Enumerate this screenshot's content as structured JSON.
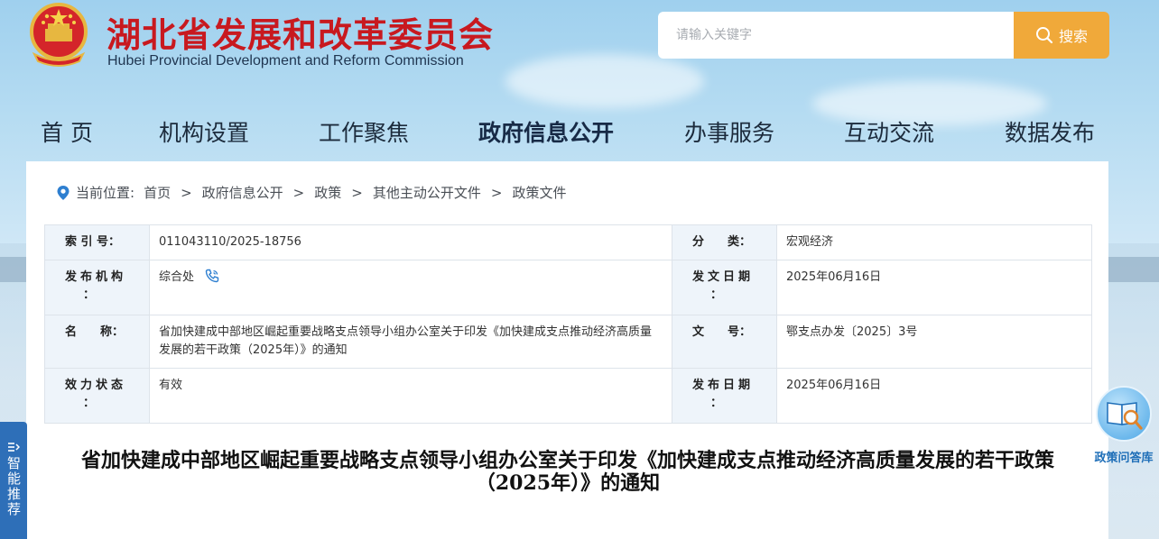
{
  "header": {
    "title_cn": "湖北省发展和改革委员会",
    "title_en": "Hubei Provincial Development and Reform Commission"
  },
  "search": {
    "placeholder": "请输入关键字",
    "button_label": "搜索"
  },
  "nav": {
    "items": [
      {
        "label": "首 页"
      },
      {
        "label": "机构设置"
      },
      {
        "label": "工作聚焦"
      },
      {
        "label": "政府信息公开"
      },
      {
        "label": "办事服务"
      },
      {
        "label": "互动交流"
      },
      {
        "label": "数据发布"
      }
    ],
    "active_index": 3
  },
  "breadcrumb": {
    "prefix": "当前位置:",
    "items": [
      "首页",
      "政府信息公开",
      "政策",
      "其他主动公开文件",
      "政策文件"
    ],
    "separator": ">"
  },
  "meta": {
    "index_label": "索 引 号：",
    "index_value": "011043110/2025-18756",
    "category_label": "分　　类：",
    "category_value": "宏观经济",
    "publisher_label_chars": [
      "发",
      "布",
      "机",
      "构",
      "："
    ],
    "publisher_value": "综合处",
    "issue_date_label_chars": [
      "发",
      "文",
      "日",
      "期",
      "："
    ],
    "issue_date_value": "2025年06月16日",
    "name_label": "名　　称：",
    "name_value": "省加快建成中部地区崛起重要战略支点领导小组办公室关于印发《加快建成支点推动经济高质量发展的若干政策（2025年）》的通知",
    "doc_no_label": "文　　号：",
    "doc_no_value": "鄂支点办发〔2025〕3号",
    "status_label_chars": [
      "效",
      "力",
      "状",
      "态",
      "："
    ],
    "status_value": "有效",
    "publish_date_label_chars": [
      "发",
      "布",
      "日",
      "期",
      "："
    ],
    "publish_date_value": "2025年06月16日"
  },
  "document": {
    "title": "省加快建成中部地区崛起重要战略支点领导小组办公室关于印发《加快建成支点推动经济高质量发展的若干政策（2025年）》的通知"
  },
  "widgets": {
    "smart_recommend": "智能推荐",
    "policy_qa": "政策问答库"
  },
  "colors": {
    "title_red": "#c8191f",
    "search_button": "#f0a93a",
    "label_cell_bg": "#eef4fa",
    "accent_blue": "#2e6fb8"
  }
}
